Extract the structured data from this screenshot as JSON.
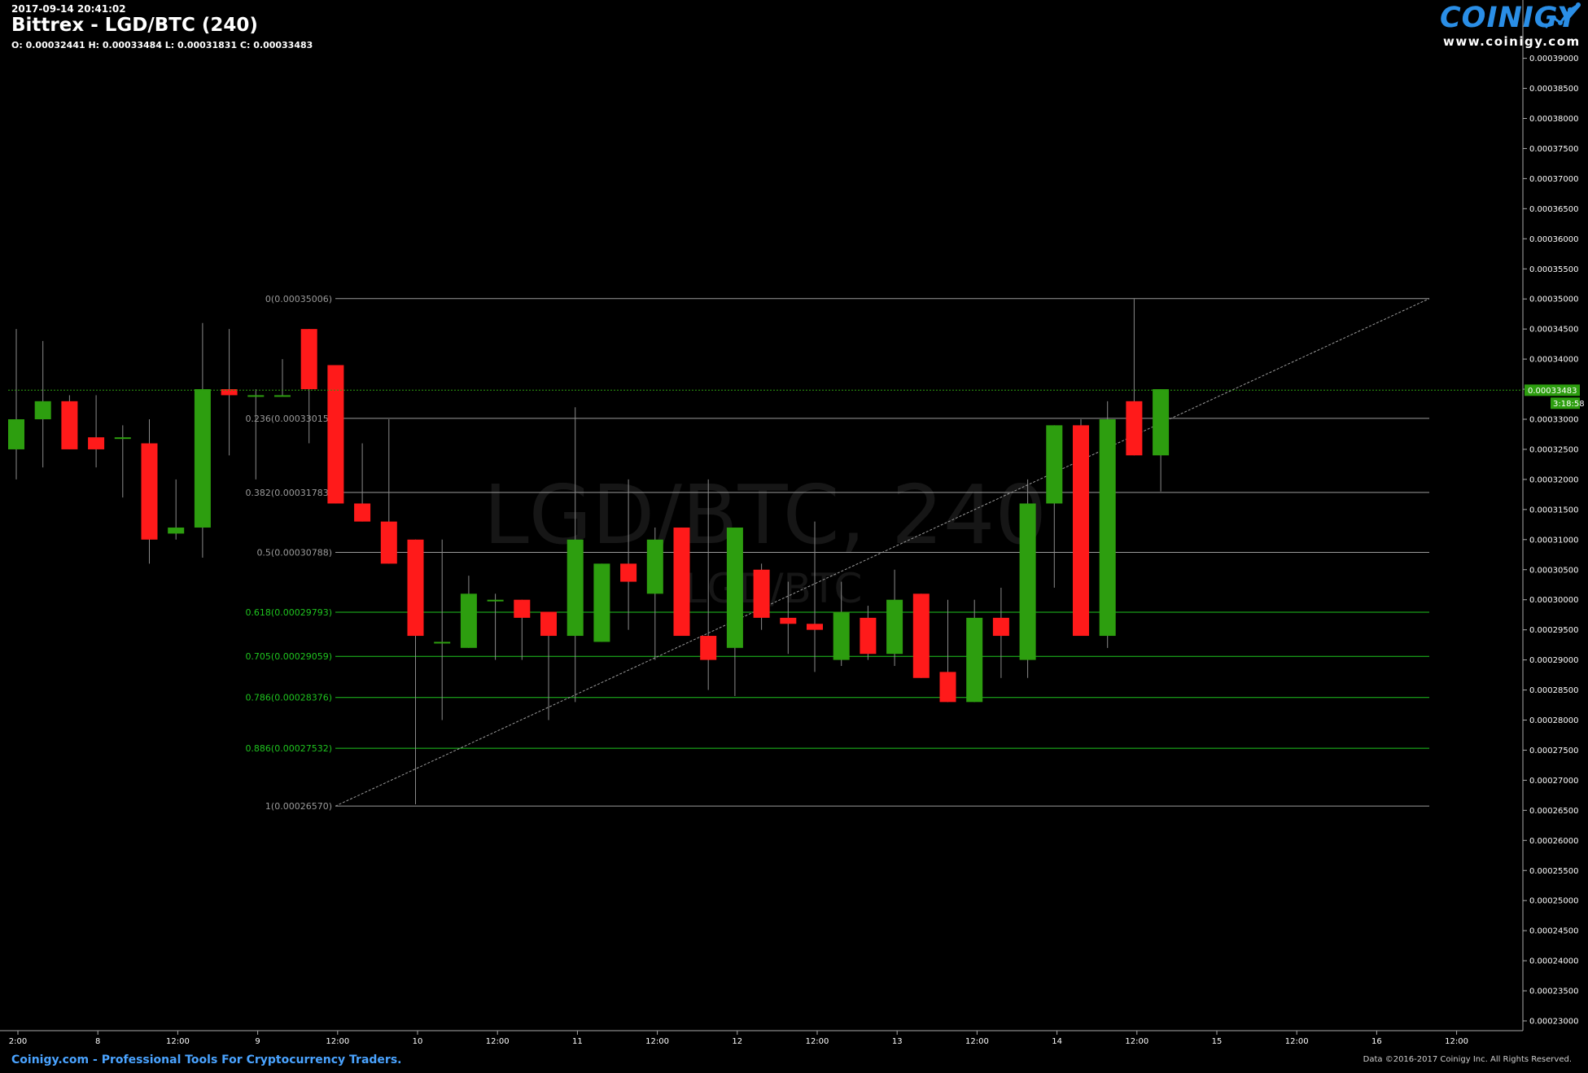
{
  "header": {
    "timestamp": "2017-09-14 20:41:02",
    "title": "Bittrex - LGD/BTC (240)",
    "ohlc": "O: 0.00032441 H: 0.00033484 L: 0.00031831 C: 0.00033483"
  },
  "logo": {
    "name": "COINIGY",
    "url": "www.coinigy.com",
    "icon": "coinigy-chart-icon"
  },
  "watermark": {
    "line1": "LGD/BTC, 240",
    "line2": "LGD/BTC"
  },
  "footer": {
    "left": "Coinigy.com - Professional Tools For Cryptocurrency Traders.",
    "right": "Data ©2016-2017 Coinigy Inc. All Rights Reserved."
  },
  "colors": {
    "background": "#000000",
    "up": "#2d9e0f",
    "down": "#ff1a1a",
    "fib_gray": "#9a9a9a",
    "fib_green": "#1fc41f",
    "current_price": "#2d9e0f",
    "logo": "#2a8ee6"
  },
  "chart_data": {
    "type": "candlestick",
    "title": "Bittrex - LGD/BTC (240)",
    "ylim": [
      0.00023,
      0.00039
    ],
    "y_ticks": [
      "0.00023000",
      "0.00023500",
      "0.00024000",
      "0.00024500",
      "0.00025000",
      "0.00025500",
      "0.00026000",
      "0.00026500",
      "0.00027000",
      "0.00027500",
      "0.00028000",
      "0.00028500",
      "0.00029000",
      "0.00029500",
      "0.00030000",
      "0.00030500",
      "0.00031000",
      "0.00031500",
      "0.00032000",
      "0.00032500",
      "0.00033000",
      "0.00033500",
      "0.00034000",
      "0.00034500",
      "0.00035000",
      "0.00035500",
      "0.00036000",
      "0.00036500",
      "0.00037000",
      "0.00037500",
      "0.00038000",
      "0.00038500",
      "0.00039000"
    ],
    "x_ticks": [
      "2:00",
      "8",
      "12:00",
      "9",
      "12:00",
      "10",
      "12:00",
      "11",
      "12:00",
      "12",
      "12:00",
      "13",
      "12:00",
      "14",
      "12:00",
      "15",
      "12:00",
      "16",
      "12:00"
    ],
    "current_price": "0.00033483",
    "countdown": "3:18:58",
    "candles": [
      {
        "o": 0.000325,
        "h": 0.000345,
        "l": 0.00032,
        "c": 0.00033
      },
      {
        "o": 0.00033,
        "h": 0.000343,
        "l": 0.000322,
        "c": 0.000333
      },
      {
        "o": 0.000333,
        "h": 0.000334,
        "l": 0.000325,
        "c": 0.000325
      },
      {
        "o": 0.000327,
        "h": 0.000334,
        "l": 0.000322,
        "c": 0.000325
      },
      {
        "o": 0.000327,
        "h": 0.000329,
        "l": 0.000317,
        "c": 0.000327
      },
      {
        "o": 0.000326,
        "h": 0.00033,
        "l": 0.000306,
        "c": 0.00031
      },
      {
        "o": 0.000311,
        "h": 0.00032,
        "l": 0.00031,
        "c": 0.000312
      },
      {
        "o": 0.000312,
        "h": 0.000346,
        "l": 0.000307,
        "c": 0.000335
      },
      {
        "o": 0.000335,
        "h": 0.000345,
        "l": 0.000324,
        "c": 0.000334
      },
      {
        "o": 0.000334,
        "h": 0.000335,
        "l": 0.00032,
        "c": 0.000334
      },
      {
        "o": 0.000334,
        "h": 0.00034,
        "l": 0.000334,
        "c": 0.000334
      },
      {
        "o": 0.000345,
        "h": 0.000345,
        "l": 0.000326,
        "c": 0.000335
      },
      {
        "o": 0.000339,
        "h": 0.000339,
        "l": 0.000316,
        "c": 0.000316
      },
      {
        "o": 0.000316,
        "h": 0.000326,
        "l": 0.000313,
        "c": 0.000313
      },
      {
        "o": 0.000313,
        "h": 0.00033,
        "l": 0.000306,
        "c": 0.000306
      },
      {
        "o": 0.00031,
        "h": 0.00031,
        "l": 0.000266,
        "c": 0.000294
      },
      {
        "o": 0.000293,
        "h": 0.00031,
        "l": 0.00028,
        "c": 0.000293
      },
      {
        "o": 0.000292,
        "h": 0.000304,
        "l": 0.000292,
        "c": 0.000301
      },
      {
        "o": 0.0003,
        "h": 0.000301,
        "l": 0.00029,
        "c": 0.0003
      },
      {
        "o": 0.0003,
        "h": 0.0003,
        "l": 0.00029,
        "c": 0.000297
      },
      {
        "o": 0.000298,
        "h": 0.000298,
        "l": 0.00028,
        "c": 0.000294
      },
      {
        "o": 0.000294,
        "h": 0.000332,
        "l": 0.000283,
        "c": 0.00031
      },
      {
        "o": 0.000293,
        "h": 0.000306,
        "l": 0.000293,
        "c": 0.000306
      },
      {
        "o": 0.000306,
        "h": 0.00032,
        "l": 0.000295,
        "c": 0.000303
      },
      {
        "o": 0.000301,
        "h": 0.000312,
        "l": 0.00029,
        "c": 0.00031
      },
      {
        "o": 0.000312,
        "h": 0.000312,
        "l": 0.000294,
        "c": 0.000294
      },
      {
        "o": 0.000294,
        "h": 0.00032,
        "l": 0.000285,
        "c": 0.00029
      },
      {
        "o": 0.000292,
        "h": 0.000312,
        "l": 0.000284,
        "c": 0.000312
      },
      {
        "o": 0.000305,
        "h": 0.000306,
        "l": 0.000295,
        "c": 0.000297
      },
      {
        "o": 0.000297,
        "h": 0.000303,
        "l": 0.000291,
        "c": 0.000296
      },
      {
        "o": 0.000296,
        "h": 0.000313,
        "l": 0.000288,
        "c": 0.000295
      },
      {
        "o": 0.00029,
        "h": 0.000303,
        "l": 0.000289,
        "c": 0.000298
      },
      {
        "o": 0.000297,
        "h": 0.000299,
        "l": 0.00029,
        "c": 0.000291
      },
      {
        "o": 0.000291,
        "h": 0.000305,
        "l": 0.000289,
        "c": 0.0003
      },
      {
        "o": 0.000301,
        "h": 0.000301,
        "l": 0.000287,
        "c": 0.000287
      },
      {
        "o": 0.000288,
        "h": 0.0003,
        "l": 0.000283,
        "c": 0.000283
      },
      {
        "o": 0.000283,
        "h": 0.0003,
        "l": 0.000283,
        "c": 0.000297
      },
      {
        "o": 0.000297,
        "h": 0.000302,
        "l": 0.000287,
        "c": 0.000294
      },
      {
        "o": 0.00029,
        "h": 0.00032,
        "l": 0.000287,
        "c": 0.000316
      },
      {
        "o": 0.000316,
        "h": 0.000329,
        "l": 0.000302,
        "c": 0.000329
      },
      {
        "o": 0.000329,
        "h": 0.00033,
        "l": 0.000294,
        "c": 0.000294
      },
      {
        "o": 0.000294,
        "h": 0.000333,
        "l": 0.000292,
        "c": 0.00033
      },
      {
        "o": 0.000333,
        "h": 0.00035,
        "l": 0.000324,
        "c": 0.000324
      },
      {
        "o": 0.000324,
        "h": 0.000335,
        "l": 0.000318,
        "c": 0.000335
      }
    ],
    "fib_levels": [
      {
        "ratio": "0",
        "value": "0.00035006",
        "label": "0(0.00035006)"
      },
      {
        "ratio": "0.236",
        "value": "0.00033015",
        "label": "0.236(0.00033015)"
      },
      {
        "ratio": "0.382",
        "value": "0.00031783",
        "label": "0.382(0.00031783)"
      },
      {
        "ratio": "0.5",
        "value": "0.00030788",
        "label": "0.5(0.00030788)"
      },
      {
        "ratio": "0.618",
        "value": "0.00029793",
        "label": "0.618(0.00029793)"
      },
      {
        "ratio": "0.705",
        "value": "0.00029059",
        "label": "0.705(0.00029059)"
      },
      {
        "ratio": "0.786",
        "value": "0.00028376",
        "label": "0.786(0.00028376)"
      },
      {
        "ratio": "0.886",
        "value": "0.00027532",
        "label": "0.886(0.00027532)"
      },
      {
        "ratio": "1",
        "value": "0.00026570",
        "label": "1(0.00026570)"
      }
    ],
    "trendline": {
      "from": 0.0002657,
      "to": 0.00035006
    }
  }
}
